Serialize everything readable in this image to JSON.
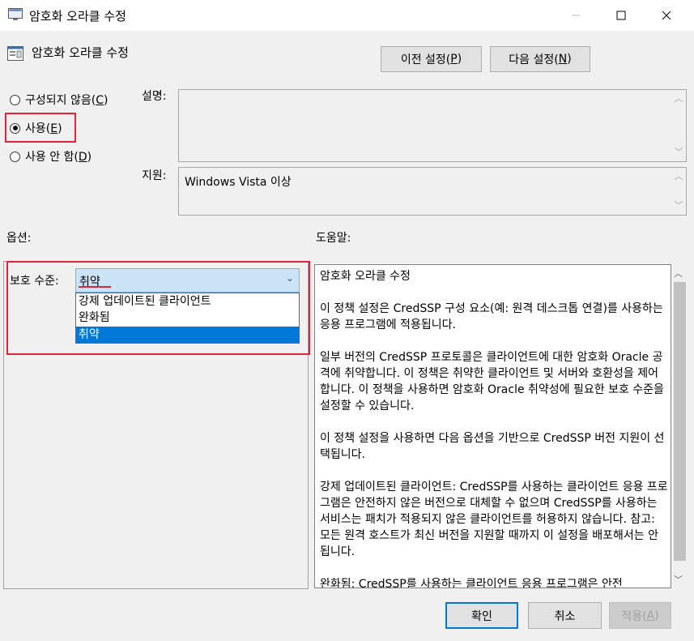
{
  "window": {
    "title": "암호화 오라클 수정"
  },
  "header": {
    "title": "암호화 오라클 수정",
    "prev_button": "이전 설정(",
    "prev_key": "P",
    "next_button": "다음 설정(",
    "next_key": "N"
  },
  "state": {
    "radios": [
      {
        "label": "구성되지 않음(",
        "key": "C",
        "checked": false
      },
      {
        "label": "사용(",
        "key": "E",
        "checked": true
      },
      {
        "label": "사용 안 함(",
        "key": "D",
        "checked": false
      }
    ]
  },
  "fields": {
    "comment_label": "설명:",
    "comment_value": "",
    "supported_label": "지원:",
    "supported_value": "Windows Vista 이상"
  },
  "sections": {
    "options_label": "옵션:",
    "help_label": "도움말:"
  },
  "options": {
    "protection_label": "보호 수준:",
    "combo_value": "취약",
    "dropdown_items": [
      "강제 업데이트된 클라이언트",
      "완화됨",
      "취약"
    ],
    "selected_index": 2
  },
  "help": {
    "paragraphs": [
      "암호화 오라클 수정",
      "이 정책 설정은 CredSSP 구성 요소(예: 원격 데스크톱 연결)를 사용하는 응용 프로그램에 적용됩니다.",
      "일부 버전의 CredSSP 프로토콜은 클라이언트에 대한 암호화 Oracle 공격에 취약합니다.  이 정책은 취약한 클라이언트 및 서버와 호환성을 제어합니다.  이 정책을 사용하면 암호화 Oracle 취약성에 필요한 보호 수준을 설정할 수 있습니다.",
      "이 정책 설정을 사용하면 다음 옵션을 기반으로 CredSSP 버전 지원이 선택됩니다.",
      "강제 업데이트된 클라이언트: CredSSP를 사용하는 클라이언트 응용 프로그램은 안전하지 않은 버전으로 대체할 수 없으며 CredSSP를 사용하는 서비스는 패치가 적용되지 않은 클라이언트를 허용하지 않습니다. 참고: 모든 원격 호스트가 최신 버전을 지원할 때까지 이 설정을 배포해서는 안됩니다.",
      "완화됨: CredSSP를 사용하는 클라이언트 응용 프로그램은 안전"
    ]
  },
  "footer": {
    "ok": "확인",
    "cancel": "취소",
    "apply": "적용(",
    "apply_key": "A"
  },
  "colors": {
    "highlight_red": "#e2233a",
    "selection_blue": "#0078d7",
    "combo_bg": "#cce4f7"
  }
}
